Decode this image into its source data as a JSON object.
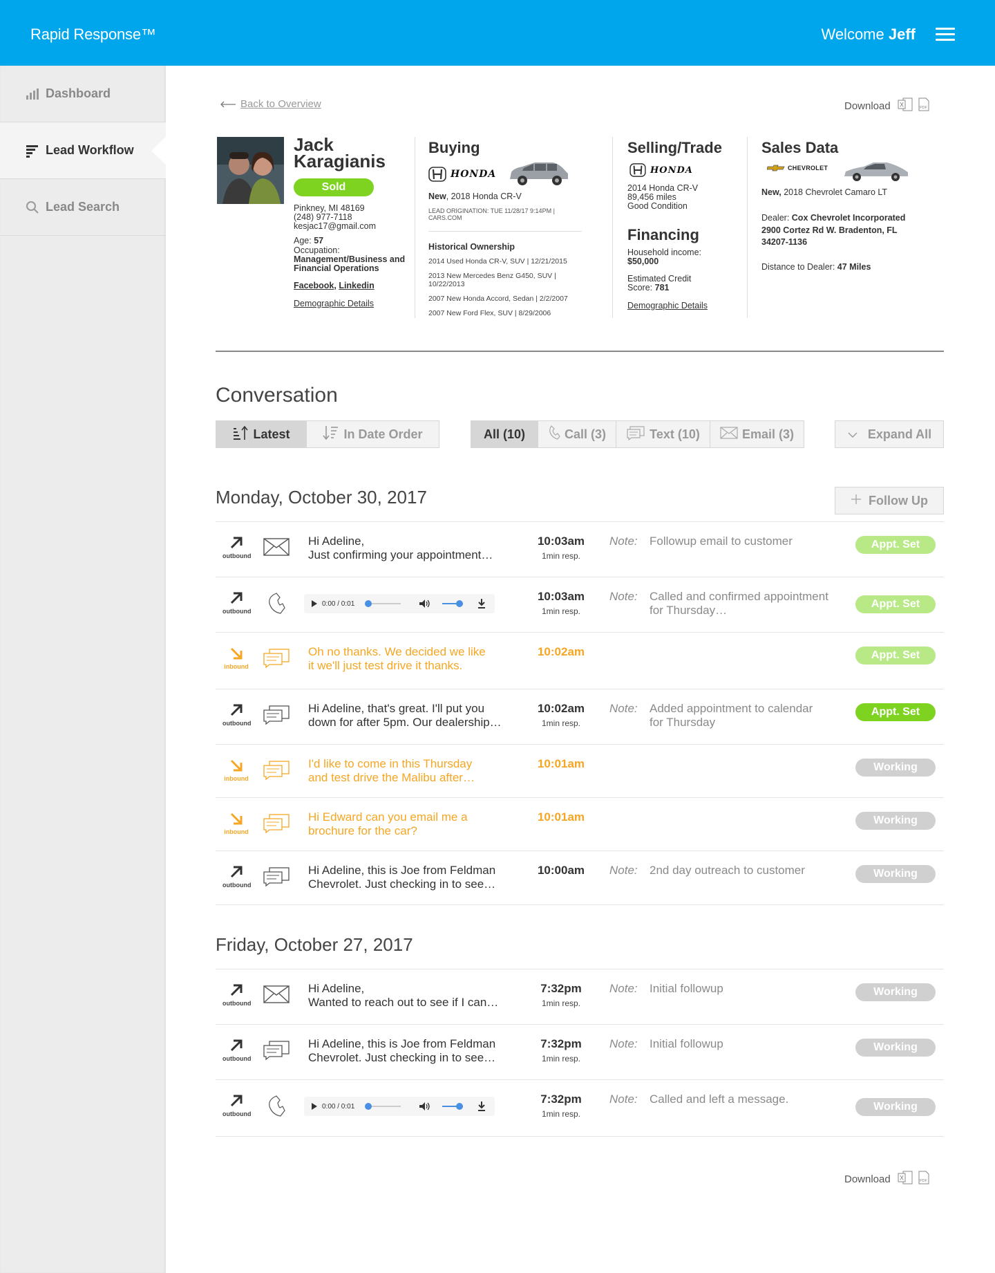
{
  "app": {
    "title": "Rapid Response™",
    "welcome": "Welcome",
    "user": "Jeff"
  },
  "colors": {
    "brand": "#00a6ec",
    "sold": "#7ed321",
    "appt_light": "#b8e986",
    "appt_dark": "#7ed321",
    "working": "#d0d0d0",
    "inbound": "#f5a623"
  },
  "sidebar": {
    "items": [
      {
        "label": "Dashboard",
        "icon": "bar-chart-icon"
      },
      {
        "label": "Lead Workflow",
        "icon": "list-icon"
      },
      {
        "label": "Lead Search",
        "icon": "search-icon"
      }
    ]
  },
  "page": {
    "back": "Back to Overview",
    "download": "Download"
  },
  "lead": {
    "first": "Jack",
    "last": "Karagianis",
    "status": "Sold",
    "city": "Pinkney, MI 48169",
    "phone": "(248) 977-7118",
    "email": "kesjac17@gmail.com",
    "age_label": "Age:",
    "age": "57",
    "occ_label": "Occupation:",
    "occupation": "Management/Business and Financial Operations",
    "facebook": "Facebook",
    "linkedin": "Linkedin",
    "sep": ", ",
    "demographic": "Demographic Details"
  },
  "buying": {
    "title": "Buying",
    "brand": "HONDA",
    "condition": "New",
    "vehicle": ", 2018 Honda CR-V",
    "origination": "LEAD ORIGINATION: TUE 11/28/17 9:14PM | CARS.COM",
    "history_title": "Historical Ownership",
    "history": [
      "2014 Used Honda CR-V, SUV  | 12/21/2015",
      "2013 New Mercedes Benz G450, SUV | 10/22/2013",
      "2007 New Honda Accord, Sedan | 2/2/2007",
      "2007 New Ford Flex, SUV | 8/29/2006"
    ]
  },
  "selling": {
    "title": "Selling/Trade",
    "brand": "HONDA",
    "vehicle": "2014 Honda CR-V",
    "miles": "89,456 miles",
    "condition": "Good Condition",
    "financing_title": "Financing",
    "income_label": "Household income:",
    "income": "$50,000",
    "credit_label": "Estimated Credit Score:",
    "credit": "781",
    "demographic": "Demographic Details"
  },
  "sales": {
    "title": "Sales Data",
    "brand": "CHEVROLET",
    "condition": "New,",
    "vehicle": "2018 Chevrolet Camaro LT",
    "dealer_label": "Dealer:",
    "dealer": "Cox Chevrolet Incorporated",
    "address1": "2900 Cortez Rd W. Bradenton, FL",
    "address2": "34207-1136",
    "distance_label": "Distance to Dealer:",
    "distance": "47 Miles"
  },
  "conversation": {
    "title": "Conversation",
    "sort": [
      "Latest",
      "In Date Order"
    ],
    "filters": [
      "All (10)",
      "Call (3)",
      "Text (10)",
      "Email (3)"
    ],
    "expand": "Expand All",
    "follow_up": "Follow Up",
    "note_label": "Note:",
    "days": [
      {
        "date": "Monday, October 30, 2017",
        "rows": [
          {
            "dir": "outbound",
            "channel": "email",
            "msg1": "Hi Adeline,",
            "msg2": "Just confirming your appointment…",
            "time": "10:03am",
            "resp": "1min resp.",
            "note": "Followup email to customer",
            "badge": "Appt. Set",
            "badge_color": "#b8e986"
          },
          {
            "dir": "outbound",
            "channel": "call",
            "audio_time": "0:00 / 0:01",
            "time": "10:03am",
            "resp": "1min resp.",
            "note": "Called and confirmed appointment for Thursday…",
            "badge": "Appt. Set",
            "badge_color": "#b8e986"
          },
          {
            "dir": "inbound",
            "channel": "text",
            "msg1": "Oh no thanks. We decided we like",
            "msg2": "it we'll just test drive it thanks.",
            "time": "10:02am",
            "badge": "Appt. Set",
            "badge_color": "#b8e986"
          },
          {
            "dir": "outbound",
            "channel": "text",
            "msg1": "Hi Adeline, that's great. I'll put you",
            "msg2": "down for after 5pm. Our dealership…",
            "time": "10:02am",
            "resp": "1min resp.",
            "note": "Added appointment to calendar for Thursday",
            "badge": "Appt. Set",
            "badge_color": "#7ed321"
          },
          {
            "dir": "inbound",
            "channel": "text",
            "msg1": "I'd like to come in this Thursday",
            "msg2": "and test drive the Malibu after…",
            "time": "10:01am",
            "badge": "Working",
            "badge_color": "#d0d0d0"
          },
          {
            "dir": "inbound",
            "channel": "text",
            "msg1": "Hi Edward can you email me a",
            "msg2": "brochure for the car?",
            "time": "10:01am",
            "badge": "Working",
            "badge_color": "#d0d0d0"
          },
          {
            "dir": "outbound",
            "channel": "text",
            "msg1": "Hi Adeline, this is Joe from Feldman",
            "msg2": "Chevrolet. Just checking in to see…",
            "time": "10:00am",
            "note": "2nd day outreach to customer",
            "badge": "Working",
            "badge_color": "#d0d0d0"
          }
        ]
      },
      {
        "date": "Friday, October 27, 2017",
        "rows": [
          {
            "dir": "outbound",
            "channel": "email",
            "msg1": "Hi Adeline,",
            "msg2": "Wanted to reach out to see if I can…",
            "time": "7:32pm",
            "resp": "1min resp.",
            "note": "Initial followup",
            "badge": "Working",
            "badge_color": "#d0d0d0"
          },
          {
            "dir": "outbound",
            "channel": "text",
            "msg1": "Hi Adeline, this is Joe from Feldman",
            "msg2": "Chevrolet. Just checking in to see…",
            "time": "7:32pm",
            "resp": "1min resp.",
            "note": "Initial followup",
            "badge": "Working",
            "badge_color": "#d0d0d0"
          },
          {
            "dir": "outbound",
            "channel": "call",
            "audio_time": "0:00 / 0:01",
            "time": "7:32pm",
            "resp": "1min resp.",
            "note": "Called and left a message.",
            "badge": "Working",
            "badge_color": "#d0d0d0"
          }
        ]
      }
    ]
  }
}
